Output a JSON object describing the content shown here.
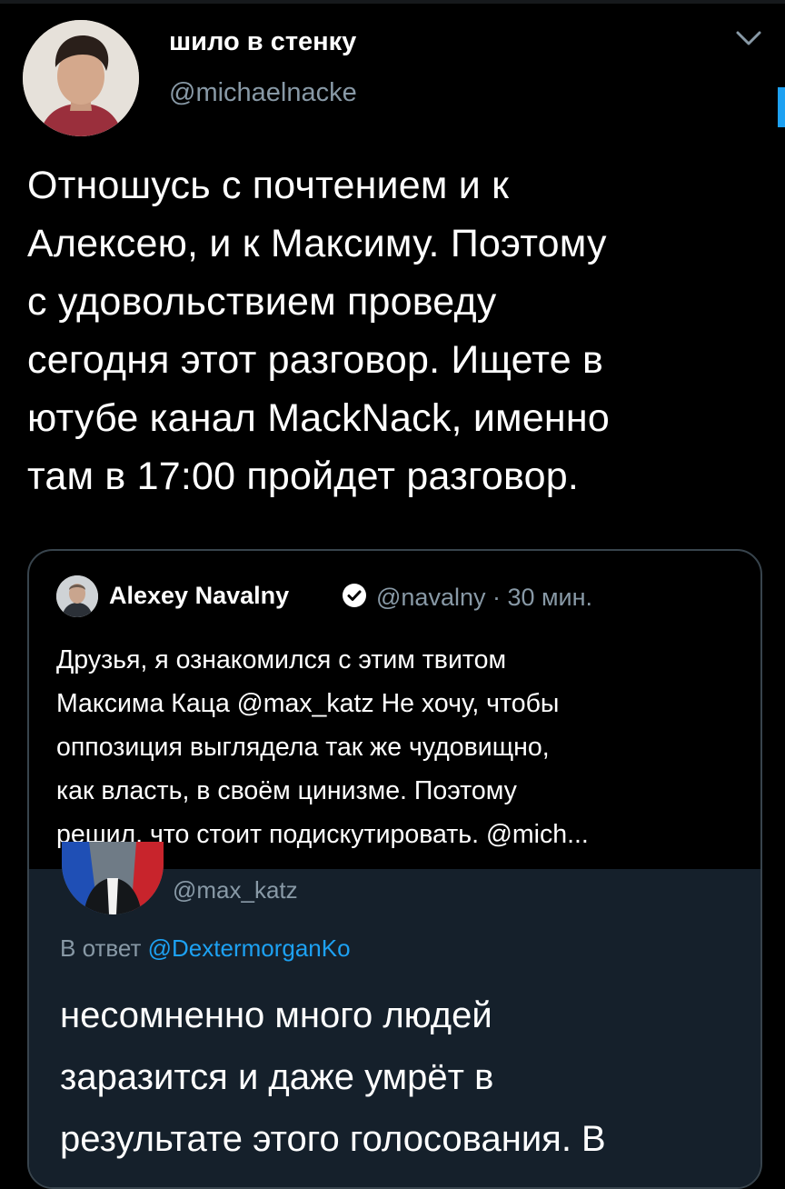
{
  "tweet": {
    "author_name": "шило в стенку",
    "author_handle": "@michaelnacke",
    "text": "Отношусь с почтением и к\nАлексею, и к Максиму. Поэтому\nс удовольствием проведу\nсегодня этот разговор. Ищете в\nютубе канал MackNack, именно\nтам в 17:00 пройдет разговор."
  },
  "quoted_tweet": {
    "author_name": "Alexey Navalny",
    "meta": "@navalny · 30 мин.",
    "text": "Друзья, я ознакомился с этим твитом\nМаксима Каца @max_katz Не хочу, чтобы\nоппозиция выглядела так же чудовищно,\nкак власть, в своём цинизме. Поэтому\nрешил, что стоит подискутировать. @mich..."
  },
  "embedded_tweet": {
    "author_handle": "@max_katz",
    "reply_prefix": "В ответ",
    "reply_to": "@DextermorganKo",
    "text": "несомненно много людей\nзаразится и даже умрёт в\nрезультате этого голосования. В"
  },
  "icons": {
    "caret": "chevron-down-icon",
    "verified": "verified-badge-icon"
  },
  "colors": {
    "background": "#000000",
    "secondary_text": "#8899a6",
    "accent": "#1da1f2",
    "embedded_background": "#15202b",
    "border": "#38444d"
  }
}
